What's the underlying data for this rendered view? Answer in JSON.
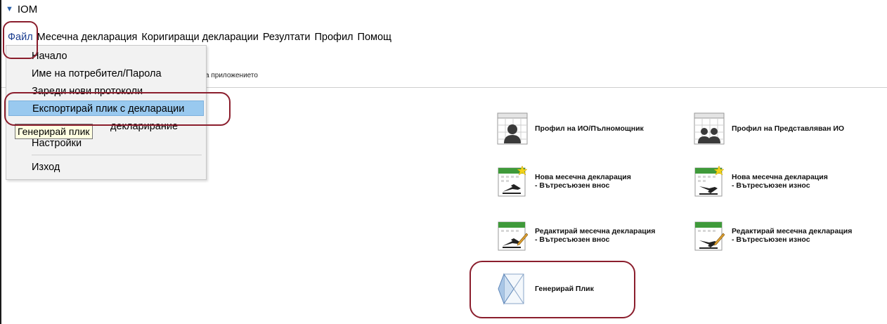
{
  "window": {
    "title": "IOM"
  },
  "menubar": {
    "items": [
      "Файл",
      "Месечна декларация",
      "Коригиращи декларации",
      "Резултати",
      "Профил",
      "Помощ"
    ]
  },
  "file_menu": {
    "items": {
      "home": "Начало",
      "user_password": "Име на потребител/Парола",
      "load_protocols": "Зареди нови протоколи",
      "export_envelope": "Експортирай плик с декларации",
      "declaring": "...декларирание",
      "settings": "Настройки",
      "exit": "Изход"
    },
    "visible_partial": "декларирание",
    "tooltip": "Генерирай плик"
  },
  "caption_fragment": "а приложението",
  "tiles": {
    "profile_io": "Профил на ИО/Пълномощник",
    "profile_represented": "Профил на Представляван ИО",
    "new_import_line1": "Нова месечна декларация",
    "new_import_line2": "- Вътресъюзен внос",
    "new_export_line1": "Нова месечна декларация",
    "new_export_line2": "- Вътресъюзен износ",
    "edit_import_line1": "Редактирай месечна декларация",
    "edit_import_line2": "- Вътресъюзен внос",
    "edit_export_line1": "Редактирай месечна декларация",
    "edit_export_line2": "- Вътресъюзен износ",
    "generate_envelope": "Генерирай Плик"
  },
  "colors": {
    "menu_highlight": "#99c9ef",
    "tooltip_bg": "#ffffe1",
    "annotation": "#8b1e2d"
  }
}
